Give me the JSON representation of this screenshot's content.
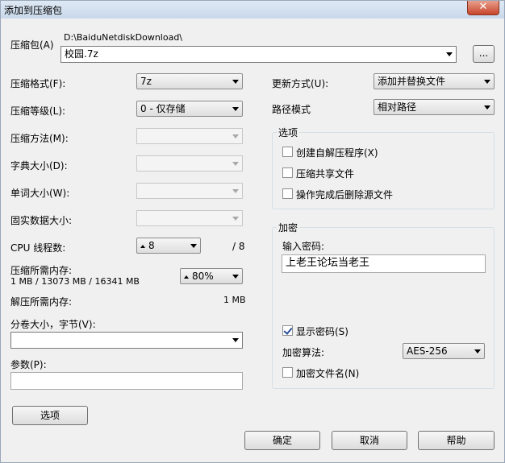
{
  "window": {
    "title": "添加到压缩包",
    "close_glyph": "✕"
  },
  "archive": {
    "label": "压缩包(A)",
    "path": "D:\\BaiduNetdiskDownload\\",
    "filename": "校园.7z",
    "browse_label": "..."
  },
  "left": {
    "format_label": "压缩格式(F):",
    "format_value": "7z",
    "level_label": "压缩等级(L):",
    "level_value": "0 - 仅存储",
    "method_label": "压缩方法(M):",
    "dict_label": "字典大小(D):",
    "word_label": "单词大小(W):",
    "solid_label": "固实数据大小:",
    "threads_label": "CPU 线程数:",
    "threads_value": "8",
    "threads_max": "/ 8",
    "mem_comp_label": "压缩所需内存:",
    "mem_comp_value": "1 MB / 13073 MB / 16341 MB",
    "mem_pct": "80%",
    "mem_decomp_label": "解压所需内存:",
    "mem_decomp_value": "1 MB",
    "volume_label": "分卷大小，字节(V):",
    "volume_value": "",
    "params_label": "参数(P):",
    "params_value": "",
    "options_button": "选项"
  },
  "right": {
    "update_label": "更新方式(U):",
    "update_value": "添加并替换文件",
    "pathmode_label": "路径模式",
    "pathmode_value": "相对路径",
    "options_group": "选项",
    "opt_sfx": "创建自解压程序(X)",
    "opt_shared": "压缩共享文件",
    "opt_delete": "操作完成后删除源文件",
    "encrypt_group": "加密",
    "password_label": "输入密码:",
    "password_value": "上老王论坛当老王",
    "show_password": "显示密码(S)",
    "algo_label": "加密算法:",
    "algo_value": "AES-256",
    "encrypt_names": "加密文件名(N)"
  },
  "buttons": {
    "ok": "确定",
    "cancel": "取消",
    "help": "帮助"
  }
}
